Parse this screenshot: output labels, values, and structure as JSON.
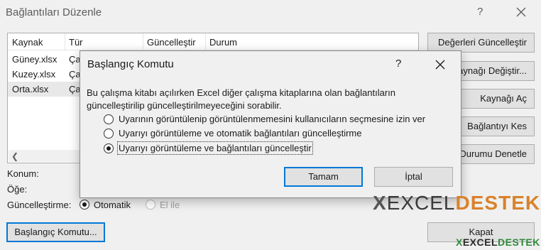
{
  "outer": {
    "title": "Bağlantıları Düzenle",
    "help": "?",
    "columns": [
      "Kaynak",
      "Tür",
      "Güncelleştir",
      "Durum"
    ],
    "rows": [
      {
        "source": "Güney.xlsx",
        "type": "Ça"
      },
      {
        "source": "Kuzey.xlsx",
        "type": "Ça"
      },
      {
        "source": "Orta.xlsx",
        "type": "Ça"
      }
    ],
    "side_buttons": [
      "Değerleri Güncelleştir",
      "Kaynağı Değiştir...",
      "Kaynağı Aç",
      "Bağlantıyı Kes",
      "Durumu Denetle"
    ],
    "labels": {
      "location": "Konum:",
      "item": "Öğe:",
      "update": "Güncelleştirme:",
      "automatic": "Otomatik",
      "manual": "El ile"
    },
    "startup_button": "Başlangıç Komutu...",
    "close_button": "Kapat"
  },
  "modal": {
    "title": "Başlangıç Komutu",
    "help": "?",
    "description": "Bu çalışma kitabı açılırken Excel diğer çalışma kitaplarına olan bağlantıların güncelleştirilip güncelleştirilmeyeceğini sorabilir.",
    "options": [
      "Uyarının görüntülenip görüntülenmemesini kullanıcıların seçmesine izin ver",
      "Uyarıyı görüntüleme ve otomatik bağlantıları güncelleştirme",
      "Uyarıyı görüntüleme ve bağlantıları güncelleştir"
    ],
    "selected_option": 2,
    "ok_label": "Tamam",
    "cancel_label": "İptal"
  },
  "watermark": {
    "mark": "X",
    "word1": "EXCEL",
    "word2": "DESTEK"
  },
  "icons": {
    "close": "close-icon",
    "scroll_left": "arrow-left-icon",
    "scroll_right": "arrow-right-icon"
  },
  "colors": {
    "accent": "#0078d7",
    "watermark_orange": "#d9822b",
    "watermark_green": "#2f8a3a"
  }
}
